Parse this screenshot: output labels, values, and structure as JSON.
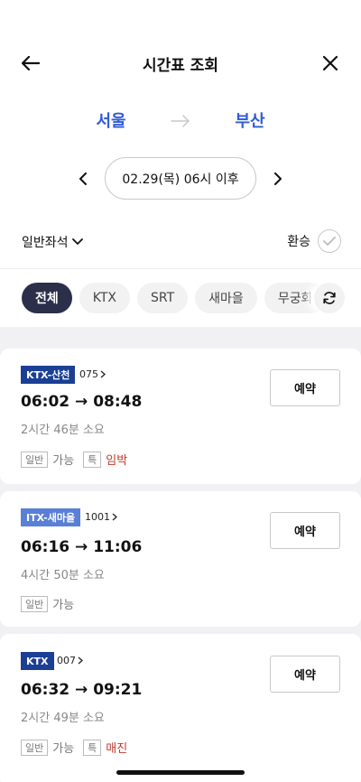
{
  "header": {
    "title": "시간표 조회"
  },
  "route": {
    "departure": "서울",
    "arrival": "부산"
  },
  "date": {
    "label": "02.29(목) 06시 이후"
  },
  "options": {
    "seat_class": "일반좌석",
    "transfer_label": "환승"
  },
  "filters": [
    {
      "label": "전체",
      "active": true
    },
    {
      "label": "KTX",
      "active": false
    },
    {
      "label": "SRT",
      "active": false
    },
    {
      "label": "새마을",
      "active": false
    },
    {
      "label": "무궁화",
      "active": false
    }
  ],
  "trains": [
    {
      "type": "KTX-산천",
      "badge_color": "#1b3f94",
      "number": "075",
      "times": "06:02 → 08:48",
      "duration": "2시간 46분 소요",
      "seats": [
        {
          "tag": "일반",
          "status": "가능"
        },
        {
          "tag": "특",
          "status": "임박"
        }
      ],
      "reserve_label": "예약"
    },
    {
      "type": "ITX-새마을",
      "badge_color": "#5a7fd6",
      "number": "1001",
      "times": "06:16 → 11:06",
      "duration": "4시간 50분 소요",
      "seats": [
        {
          "tag": "일반",
          "status": "가능"
        }
      ],
      "reserve_label": "예약"
    },
    {
      "type": "KTX",
      "badge_color": "#1b3f94",
      "number": "007",
      "times": "06:32 → 09:21",
      "duration": "2시간 49분 소요",
      "seats": [
        {
          "tag": "일반",
          "status": "가능"
        },
        {
          "tag": "특",
          "status": "매진"
        }
      ],
      "reserve_label": "예약"
    }
  ],
  "colors": {
    "accent": "#2f5bd7",
    "active_chip": "#2b2f4a",
    "warning": "#c0392b",
    "ktx_badge": "#1b3f94",
    "itx_badge": "#5a7fd6"
  },
  "icons": {
    "back": "arrow-left-icon",
    "close": "close-icon",
    "route": "arrow-right-icon",
    "prev": "chevron-left-icon",
    "next": "chevron-right-icon",
    "dropdown": "chevron-down-icon",
    "check": "check-icon",
    "refresh": "refresh-icon"
  }
}
